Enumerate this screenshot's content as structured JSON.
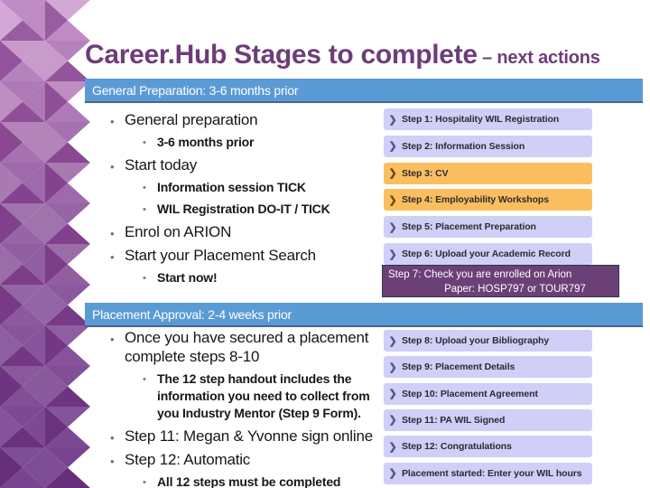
{
  "slide": {
    "title_main": "Career.Hub Stages to complete",
    "title_sub": " – next actions"
  },
  "sections": {
    "general": {
      "bar_label": "General Preparation:  3-6 months prior",
      "bullets": [
        {
          "level": 1,
          "text": "General preparation"
        },
        {
          "level": 2,
          "text": "3-6 months prior"
        },
        {
          "level": 1,
          "text": "Start today"
        },
        {
          "level": 2,
          "text": "Information session TICK"
        },
        {
          "level": 2,
          "text": "WIL Registration DO-IT / TICK"
        },
        {
          "level": 1,
          "text": "Enrol on ARION"
        },
        {
          "level": 1,
          "text": "Start your Placement Search"
        },
        {
          "level": 2,
          "text": "Start now!"
        }
      ]
    },
    "approval": {
      "bar_label": "Placement Approval: 2-4 weeks prior",
      "bullets": [
        {
          "level": 1,
          "text": "Once you have secured a placement complete steps 8-10"
        },
        {
          "level": 2,
          "text": "The 12 step handout includes the information you need to collect from you Industry Mentor (Step 9 Form)."
        },
        {
          "level": 1,
          "text": "Step 11: Megan & Yvonne sign online"
        },
        {
          "level": 1,
          "text": "Step 12: Automatic"
        },
        {
          "level": 2,
          "text": "All 12 steps must be completed"
        }
      ]
    }
  },
  "steps_top": [
    {
      "label": "Step 1: Hospitality WIL Registration",
      "style": "lav",
      "chevron": "❯"
    },
    {
      "label": "Step 2: Information Session",
      "style": "lav",
      "chevron": "❯"
    },
    {
      "label": "Step 3: CV",
      "style": "org",
      "chevron": "❯"
    },
    {
      "label": "Step 4: Employability Workshops",
      "style": "org",
      "chevron": "❯"
    },
    {
      "label": "Step 5: Placement Preparation",
      "style": "lav",
      "chevron": "❯"
    },
    {
      "label": "Step 6: Upload your Academic Record",
      "style": "lav",
      "chevron": "❯"
    }
  ],
  "step7": {
    "line1": "Step 7:  Check you are enrolled on Arion",
    "line2": "Paper: HOSP797 or TOUR797"
  },
  "steps_bottom": [
    {
      "label": "Step 8: Upload your Bibliography",
      "style": "lav",
      "chevron": "❯"
    },
    {
      "label": "Step 9: Placement Details",
      "style": "lav",
      "chevron": "❯"
    },
    {
      "label": "Step 10: Placement Agreement",
      "style": "lav",
      "chevron": "❯"
    },
    {
      "label": "Step 11: PA WIL Signed",
      "style": "lav",
      "chevron": "❯"
    },
    {
      "label": "Step 12: Congratulations",
      "style": "lav",
      "chevron": "❯"
    },
    {
      "label": "Placement started: Enter your WIL hours",
      "style": "lav",
      "chevron": "❯"
    }
  ],
  "colors": {
    "title_purple": "#6E3D79",
    "bar_blue": "#5B9BD5",
    "step_lavender": "#CFCFF7",
    "step_orange": "#FBBE5E",
    "step7_purple": "#6B4077"
  }
}
